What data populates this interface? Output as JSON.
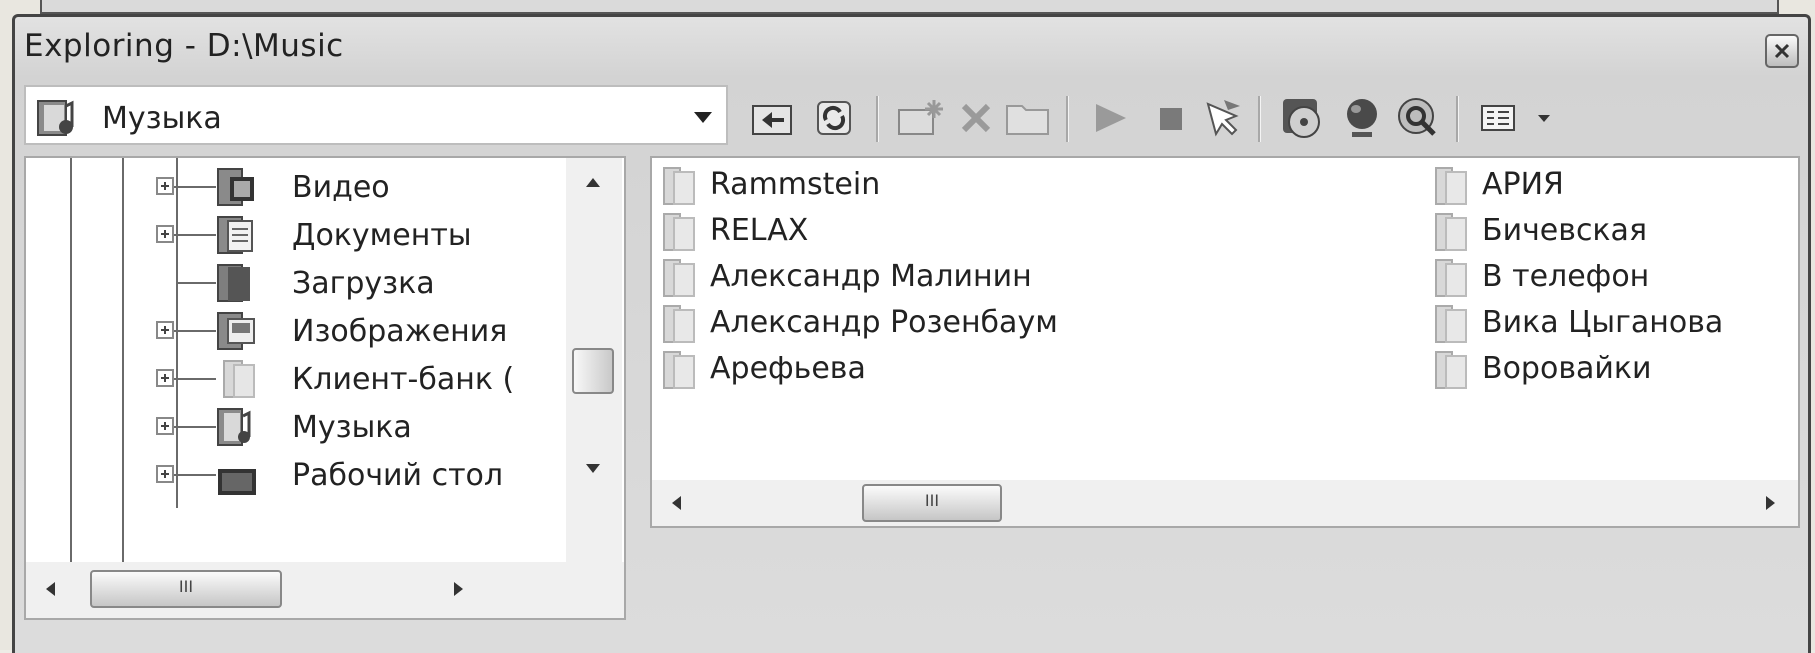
{
  "window": {
    "title": "Exploring - D:\\Music"
  },
  "address": {
    "value": "Музыка"
  },
  "toolbar": {
    "buttons": [
      "up-folder-icon",
      "refresh-icon",
      "new-folder-icon",
      "delete-icon",
      "folder-icon",
      "play-icon",
      "stop-icon",
      "select-icon",
      "disc-icon",
      "globe-icon",
      "search-disc-icon",
      "view-icon"
    ]
  },
  "tree": {
    "items": [
      {
        "label": "Видео",
        "expandable": true
      },
      {
        "label": "Документы",
        "expandable": true
      },
      {
        "label": "Загрузка",
        "expandable": false
      },
      {
        "label": "Изображения",
        "expandable": true
      },
      {
        "label": "Клиент-банк (",
        "expandable": true
      },
      {
        "label": "Музыка",
        "expandable": true
      },
      {
        "label": "Рабочий стол",
        "expandable": true
      }
    ],
    "hscroll_thumb": "III"
  },
  "files": {
    "col1": [
      "Rammstein",
      "RELAX",
      "Александр Малинин",
      "Александр Розенбаум",
      "Арефьева"
    ],
    "col2": [
      "АРИЯ",
      "Бичевская",
      "В телефон",
      "Вика Цыганова",
      "Воровайки"
    ],
    "hscroll_thumb": "III"
  }
}
